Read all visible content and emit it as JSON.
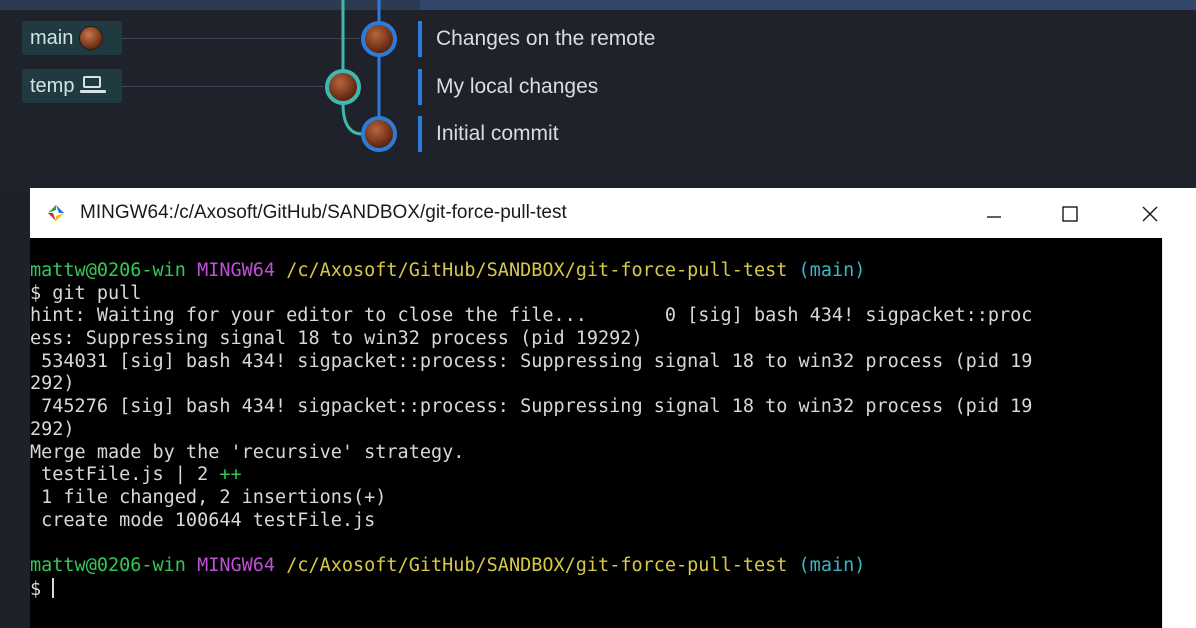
{
  "graph": {
    "branches": [
      {
        "label": "main",
        "icon": "avatar"
      },
      {
        "label": "temp",
        "icon": "laptop-icon"
      }
    ],
    "commits": [
      {
        "message": "Changes on the remote"
      },
      {
        "message": "My local changes"
      },
      {
        "message": "Initial commit"
      }
    ]
  },
  "terminal": {
    "window_title": "MINGW64:/c/Axosoft/GitHub/SANDBOX/git-force-pull-test",
    "prompt": {
      "user_host": "mattw@0206-win",
      "system": "MINGW64",
      "path": "/c/Axosoft/GitHub/SANDBOX/git-force-pull-test",
      "branch": "(main)"
    },
    "command_line": "$ git pull",
    "output": [
      "hint: Waiting for your editor to close the file...       0 [sig] bash 434! sigpacket::proc",
      "ess: Suppressing signal 18 to win32 process (pid 19292)",
      " 534031 [sig] bash 434! sigpacket::process: Suppressing signal 18 to win32 process (pid 19",
      "292)",
      " 745276 [sig] bash 434! sigpacket::process: Suppressing signal 18 to win32 process (pid 19",
      "292)",
      "Merge made by the 'recursive' strategy."
    ],
    "diffstat_file": " testFile.js | 2 ",
    "diffstat_plus": "++",
    "summary": [
      " 1 file changed, 2 insertions(+)",
      " create mode 100644 testFile.js"
    ],
    "final_prompt": "$ "
  },
  "colors": {
    "user_host": "#34c759",
    "system": "#c04fd6",
    "path": "#d7c84a",
    "branch": "#3ab6c8",
    "graph_blue": "#2f7bd8",
    "graph_teal": "#3fb8b0"
  }
}
